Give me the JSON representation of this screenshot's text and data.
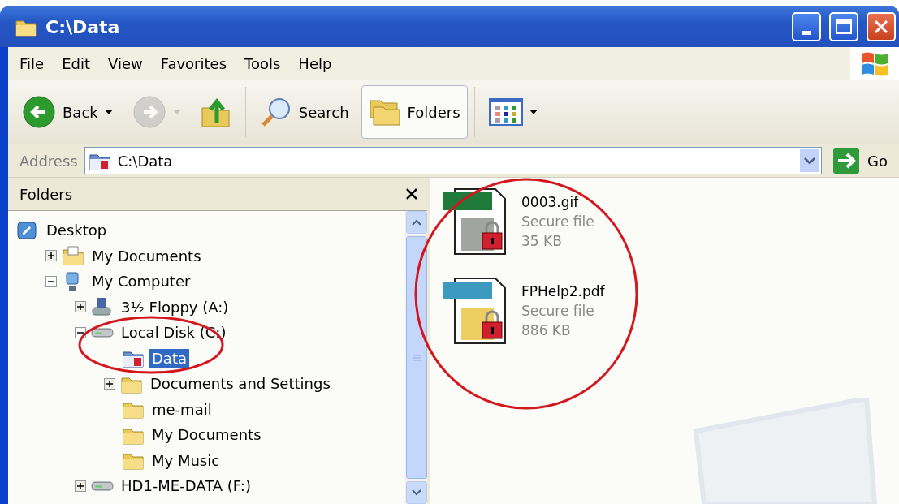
{
  "window": {
    "title": "C:\\Data"
  },
  "menu": [
    {
      "label": "File"
    },
    {
      "label": "Edit"
    },
    {
      "label": "View"
    },
    {
      "label": "Favorites"
    },
    {
      "label": "Tools"
    },
    {
      "label": "Help"
    }
  ],
  "toolbar": [
    {
      "kind": "back",
      "label": "Back",
      "dropdown": true,
      "disabled": false,
      "selected": false
    },
    {
      "kind": "forward",
      "dropdown": true,
      "disabled": true,
      "selected": false
    },
    {
      "kind": "up",
      "dropdown": false,
      "disabled": false,
      "selected": false
    },
    {
      "kind": "search",
      "label": "Search",
      "dropdown": false,
      "disabled": false,
      "selected": false
    },
    {
      "kind": "folders",
      "label": "Folders",
      "dropdown": false,
      "disabled": false,
      "selected": true
    },
    {
      "kind": "views",
      "dropdown": true,
      "disabled": false,
      "selected": false
    }
  ],
  "address": {
    "label": "Address",
    "value": "C:\\Data",
    "go": "Go"
  },
  "folders_pane": {
    "title": "Folders",
    "tree": [
      {
        "label": "Desktop",
        "kind": "desktop",
        "selected": false,
        "children": [
          {
            "label": "My Documents",
            "kind": "documents",
            "expandable": true,
            "expanded": false,
            "selected": false
          },
          {
            "label": "My Computer",
            "kind": "computer",
            "expandable": true,
            "expanded": true,
            "selected": false,
            "children": [
              {
                "label": "3½ Floppy (A:)",
                "kind": "floppy",
                "expandable": true,
                "expanded": false,
                "selected": false
              },
              {
                "label": "Local Disk (C:)",
                "kind": "drive",
                "expandable": true,
                "expanded": true,
                "selected": false,
                "children": [
                  {
                    "label": "Data",
                    "kind": "secure-folder",
                    "expandable": false,
                    "selected": true
                  },
                  {
                    "label": "Documents and Settings",
                    "kind": "folder",
                    "expandable": true,
                    "expanded": false,
                    "selected": false
                  },
                  {
                    "label": "me-mail",
                    "kind": "folder",
                    "expandable": false,
                    "selected": false
                  },
                  {
                    "label": "My Documents",
                    "kind": "folder",
                    "expandable": false,
                    "selected": false
                  },
                  {
                    "label": "My Music",
                    "kind": "folder",
                    "expandable": false,
                    "selected": false
                  }
                ]
              },
              {
                "label": "HD1-ME-DATA (F:)",
                "kind": "drive",
                "expandable": true,
                "expanded": false,
                "selected": false
              }
            ]
          }
        ]
      }
    ]
  },
  "files": [
    {
      "name": "0003.gif",
      "type": "Secure file",
      "size": "35 KB",
      "kind": "gif"
    },
    {
      "name": "FPHelp2.pdf",
      "type": "Secure file",
      "size": "886 KB",
      "kind": "pdf"
    }
  ]
}
